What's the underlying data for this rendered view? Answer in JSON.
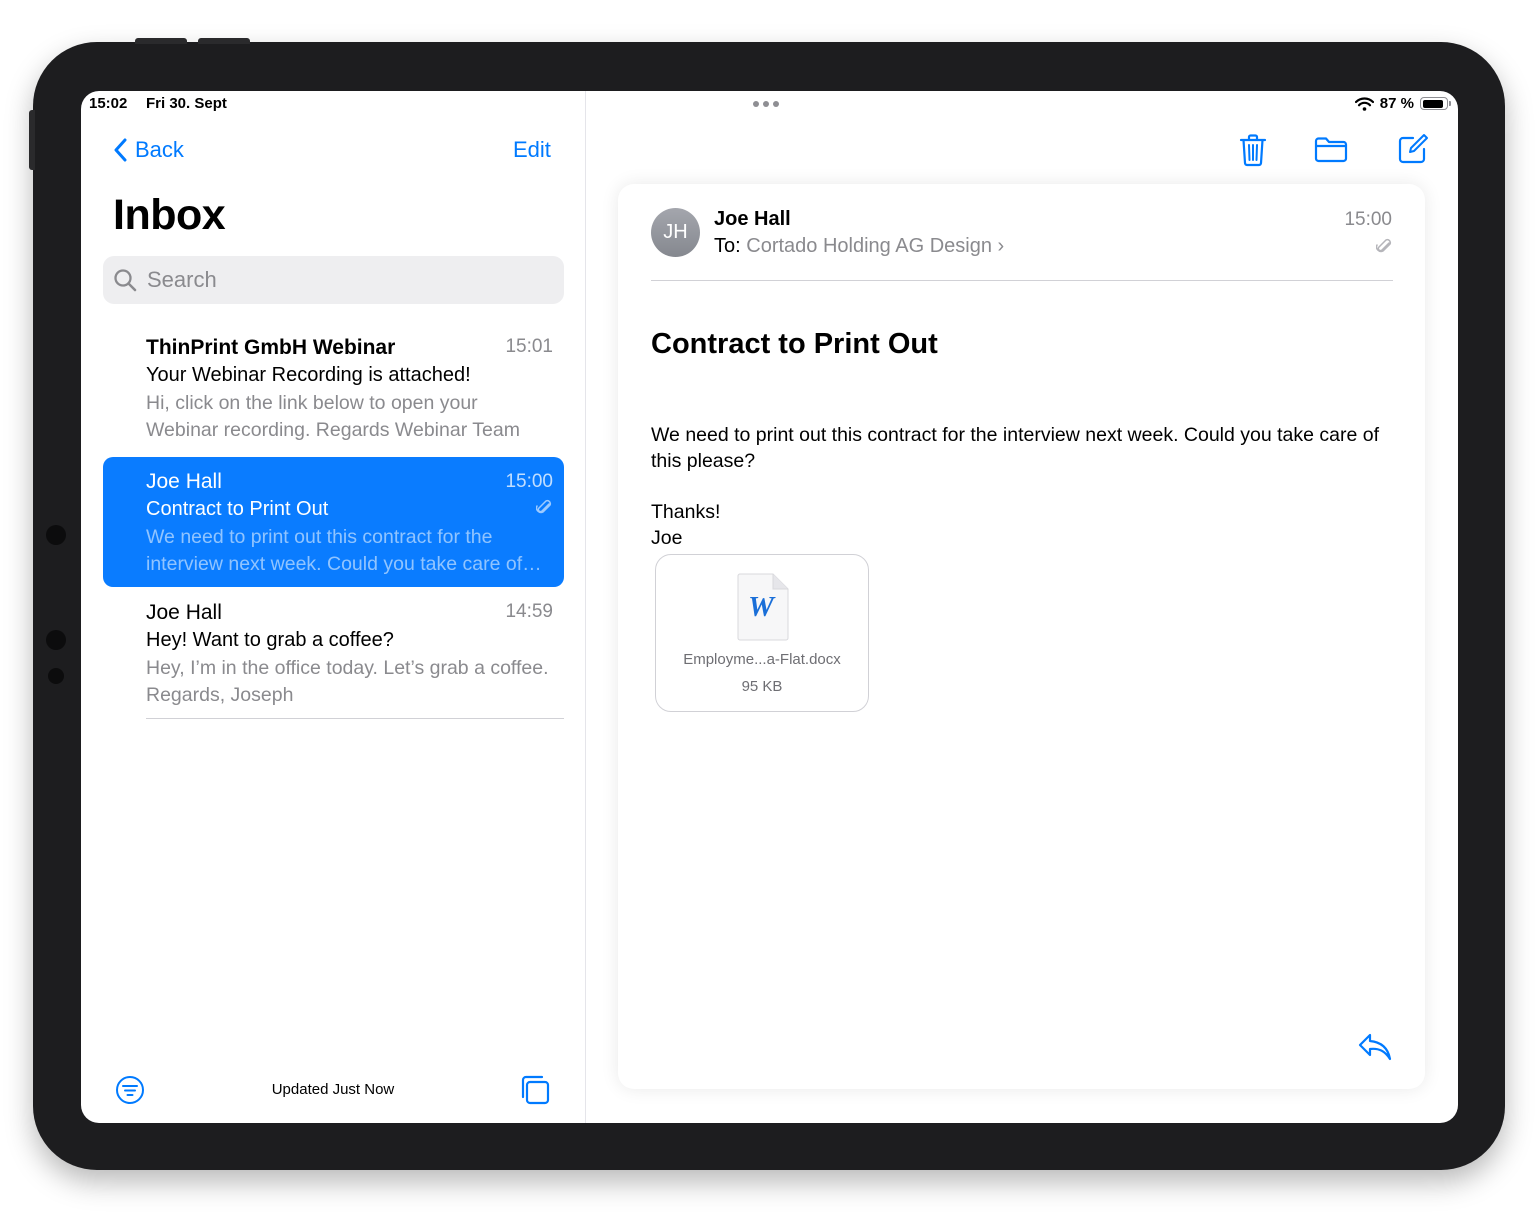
{
  "status_bar": {
    "time": "15:02",
    "date": "Fri 30. Sept",
    "battery": "87 %"
  },
  "sidebar": {
    "back_label": "Back",
    "edit_label": "Edit",
    "title": "Inbox",
    "search_placeholder": "Search",
    "messages": [
      {
        "sender": "ThinPrint GmbH Webinar",
        "time": "15:01",
        "subject": "Your Webinar Recording is attached!",
        "preview": "Hi, click on the link below to open your Webinar recording. Regards Webinar Team"
      },
      {
        "sender": "Joe Hall",
        "time": "15:00",
        "subject": "Contract to Print Out",
        "preview": "We need to print out this contract for the interview next week. Could you take care of this please?"
      },
      {
        "sender": "Joe Hall",
        "time": "14:59",
        "subject": "Hey! Want to grab a coffee?",
        "preview": "Hey, I’m in the office today. Let’s grab a coffee. Regards, Joseph"
      }
    ],
    "updated_text": "Updated Just Now"
  },
  "detail": {
    "avatar_initials": "JH",
    "sender": "Joe Hall",
    "to_label": "To:",
    "recipient": "Cortado Holding AG Design",
    "chevron": "›",
    "time": "15:00",
    "subject": "Contract to Print Out",
    "body_line1": "We need to print out this contract for the interview next week. Could you take care of this please?",
    "body_thanks": "Thanks!",
    "body_signoff": "Joe",
    "attachment": {
      "letter": "W",
      "name": "Employme...a-Flat.docx",
      "size": "95 KB"
    }
  },
  "colors": {
    "accent": "#007aff",
    "selected_row": "#0a7cff",
    "secondary_text": "#8a8a8e"
  },
  "icons": [
    "back-chevron-icon",
    "search-icon",
    "paperclip-icon",
    "filter-icon",
    "stack-icon",
    "trash-icon",
    "folder-icon",
    "compose-icon",
    "reply-icon",
    "wifi-icon",
    "battery-icon",
    "word-doc-icon"
  ]
}
